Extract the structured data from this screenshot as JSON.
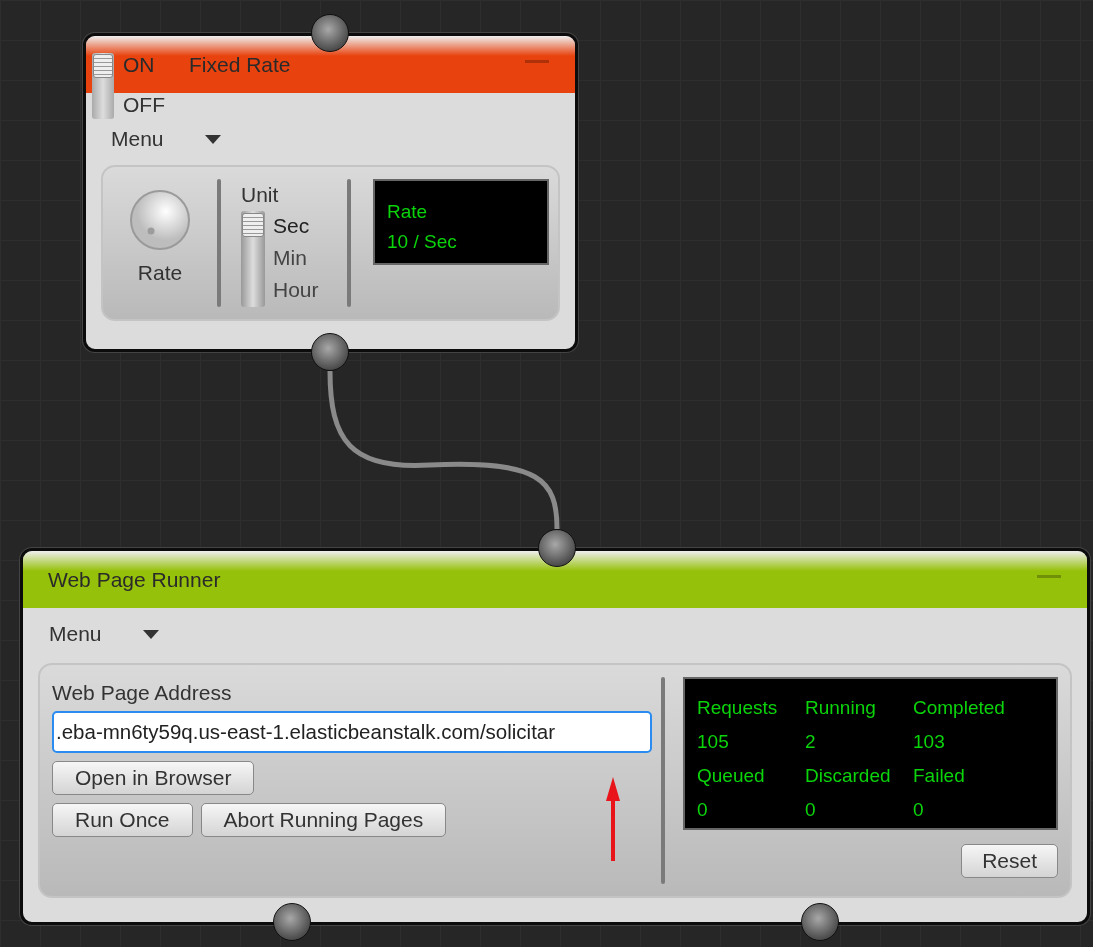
{
  "nodes": [
    {
      "kind": "fixed-rate",
      "title": "Fixed Rate",
      "color": "#e8420e",
      "toggle": {
        "on_label": "ON",
        "off_label": "OFF",
        "on": true
      },
      "menu": "Menu",
      "knob_label": "Rate",
      "unit": {
        "label": "Unit",
        "options": [
          {
            "label": "Sec",
            "selected": true
          },
          {
            "label": "Min",
            "selected": false
          },
          {
            "label": "Hour",
            "selected": false
          }
        ]
      },
      "display": [
        "Rate",
        "10 / Sec"
      ]
    },
    {
      "kind": "web-runner",
      "title": "Web Page Runner",
      "color": "#96c10a",
      "menu": "Menu",
      "address": {
        "label": "Web Page Address",
        "value": ".eba-mn6ty59q.us-east-1.elasticbeanstalk.com/solicitar"
      },
      "buttons": [
        [
          "Open in Browser"
        ],
        [
          "Run Once",
          "Abort Running Pages"
        ]
      ],
      "stats": [
        {
          "label": "Requests",
          "value": "105"
        },
        {
          "label": "Running",
          "value": "2"
        },
        {
          "label": "Completed",
          "value": "103"
        },
        {
          "label": "Queued",
          "value": "0"
        },
        {
          "label": "Discarded",
          "value": "0"
        },
        {
          "label": "Failed",
          "value": "0"
        }
      ],
      "reset": "Reset"
    }
  ]
}
